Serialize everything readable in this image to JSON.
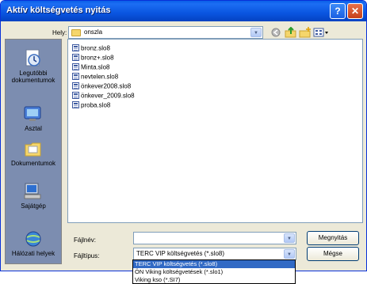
{
  "window": {
    "title": "Aktív költségvetés nyitás",
    "help_glyph": "?",
    "close_glyph": "✕"
  },
  "location": {
    "label": "Hely:",
    "value": "onszla"
  },
  "toolbar": {
    "icons": [
      "back-icon",
      "up-folder-icon",
      "new-folder-icon",
      "view-menu-icon"
    ]
  },
  "places": [
    {
      "label": "Legutóbbi dokumentumok",
      "icon": "recent-documents-icon"
    },
    {
      "label": "Asztal",
      "icon": "desktop-icon"
    },
    {
      "label": "Dokumentumok",
      "icon": "documents-icon"
    },
    {
      "label": "Sajátgép",
      "icon": "my-computer-icon"
    },
    {
      "label": "Hálózati helyek",
      "icon": "network-places-icon"
    }
  ],
  "files": [
    "bronz.slo8",
    "bronz+.slo8",
    "Minta.slo8",
    "nevtelen.slo8",
    "önkever2008.slo8",
    "önkever_2009.slo8",
    "proba.slo8"
  ],
  "filename": {
    "label": "Fájlnév:",
    "value": ""
  },
  "filetype": {
    "label": "Fájltípus:",
    "value": "TERC VIP költségvetés (*.slo8)",
    "options": [
      "TERC VIP költségvetés (*.slo8)",
      "ÖN Viking költségvetések (*.slo1)",
      "Viking kso (*.SI7)"
    ]
  },
  "buttons": {
    "open": "Megnyitás",
    "cancel": "Mégse"
  },
  "colors": {
    "titlebar": "#0a55e0",
    "dialog": "#ece9d8",
    "selection": "#316ac5"
  }
}
